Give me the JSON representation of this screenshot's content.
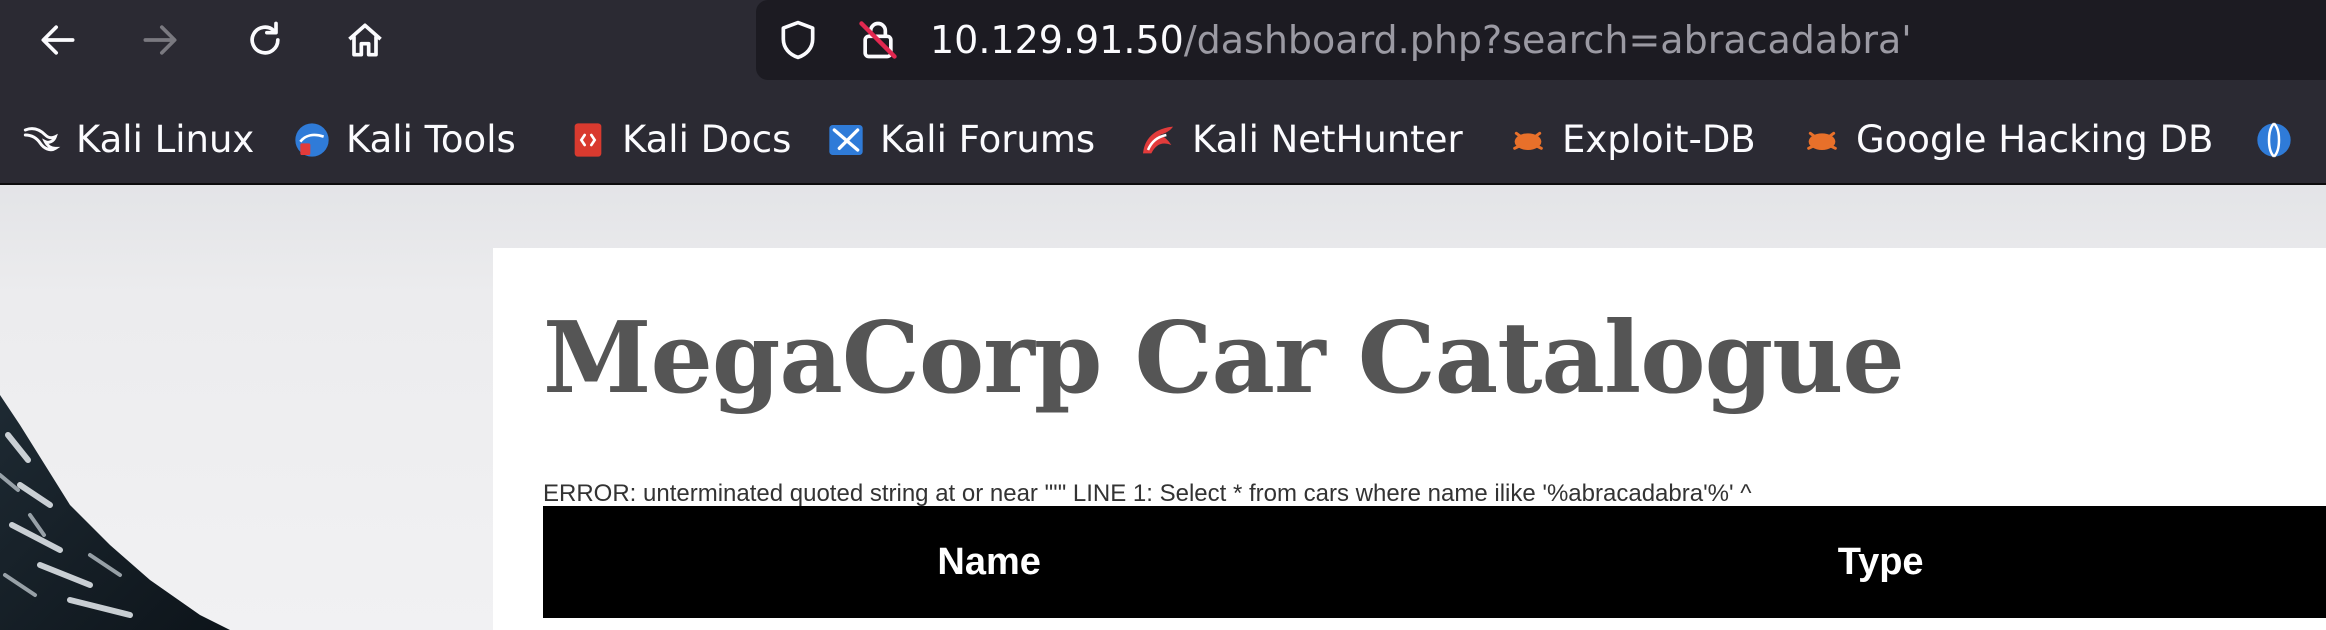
{
  "browser": {
    "nav": {
      "back_icon": "arrow-left-icon",
      "forward_icon": "arrow-right-icon",
      "reload_icon": "reload-icon",
      "home_icon": "home-icon"
    },
    "urlbar": {
      "host": "10.129.91.50",
      "path": "/dashboard.php?search=abracadabra'",
      "security_icon": "shield-icon",
      "lock_icon": "insecure-lock-icon"
    },
    "bookmarks": [
      {
        "label": "Kali Linux",
        "icon": "kali-dragon-icon"
      },
      {
        "label": "Kali Tools",
        "icon": "kali-tools-icon"
      },
      {
        "label": "Kali Docs",
        "icon": "kali-docs-icon"
      },
      {
        "label": "Kali Forums",
        "icon": "kali-forums-icon"
      },
      {
        "label": "Kali NetHunter",
        "icon": "nethunter-icon"
      },
      {
        "label": "Exploit-DB",
        "icon": "exploit-db-icon"
      },
      {
        "label": "Google Hacking DB",
        "icon": "ghdb-icon"
      }
    ],
    "colors": {
      "toolbar": "#2b2a33",
      "urlbar": "#1c1b22"
    }
  },
  "page": {
    "title": "MegaCorp Car Catalogue",
    "error": "ERROR: unterminated quoted string at or near \"'\" LINE 1: Select * from cars where name ilike '%abracadabra'%' ^",
    "table": {
      "headers": [
        "Name",
        "Type"
      ]
    }
  }
}
